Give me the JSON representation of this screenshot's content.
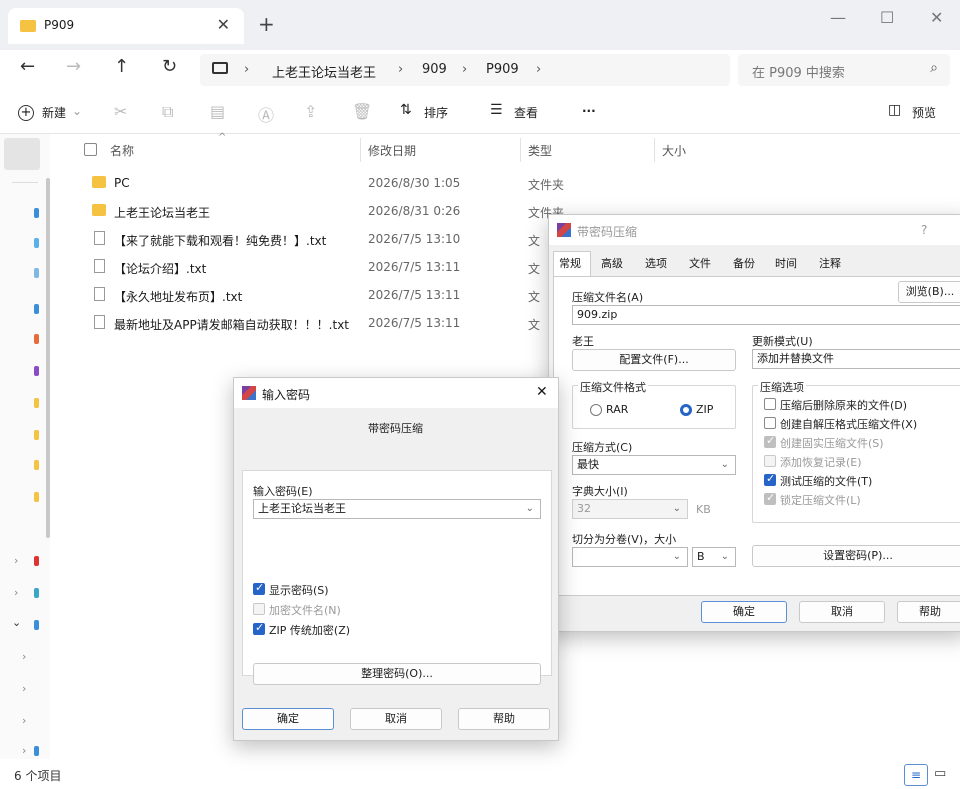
{
  "explorer": {
    "tab_title": "P909",
    "tab_close": "✕",
    "new_tab": "+",
    "window_controls": {
      "minimize": "—",
      "maximize": "☐",
      "close": "✕"
    },
    "nav": {
      "back": "←",
      "forward": "→",
      "up": "↑",
      "refresh": "↻"
    },
    "breadcrumbs": [
      "上老王论坛当老王",
      "909",
      "P909"
    ],
    "crumb_sep": "›",
    "search_placeholder": "在 P909 中搜索",
    "toolbar": {
      "new": "新建",
      "sort": "排序",
      "view": "查看",
      "more": "···",
      "preview": "预览"
    },
    "columns": {
      "name": "名称",
      "modified": "修改日期",
      "type": "类型",
      "size": "大小"
    },
    "files": [
      {
        "name": "PC",
        "date": "2026/8/30 1:05",
        "type": "文件夹",
        "kind": "folder"
      },
      {
        "name": "上老王论坛当老王",
        "date": "2026/8/31 0:26",
        "type": "文件夹",
        "kind": "folder"
      },
      {
        "name": "【来了就能下载和观看！纯免费！】.txt",
        "date": "2026/7/5 13:10",
        "type": "文",
        "kind": "txt"
      },
      {
        "name": "【论坛介绍】.txt",
        "date": "2026/7/5 13:11",
        "type": "文",
        "kind": "txt"
      },
      {
        "name": "【永久地址发布页】.txt",
        "date": "2026/7/5 13:11",
        "type": "文",
        "kind": "txt"
      },
      {
        "name": "最新地址及APP请发邮箱自动获取！！！.txt",
        "date": "2026/7/5 13:11",
        "type": "文",
        "kind": "txt"
      }
    ],
    "status": "6 个项目"
  },
  "compress_dialog": {
    "title": "带密码压缩",
    "help": "?",
    "tabs": [
      "常规",
      "高级",
      "选项",
      "文件",
      "备份",
      "时间",
      "注释"
    ],
    "archive_name_label": "压缩文件名(A)",
    "browse": "浏览(B)...",
    "archive_name": "909.zip",
    "profile_label": "老王",
    "profile_button": "配置文件(F)...",
    "update_mode_label": "更新模式(U)",
    "update_mode": "添加并替换文件",
    "format_label": "压缩文件格式",
    "format_rar": "RAR",
    "format_zip": "ZIP",
    "options_label": "压缩选项",
    "options": [
      {
        "label": "压缩后删除原来的文件(D)",
        "state": "off"
      },
      {
        "label": "创建自解压格式压缩文件(X)",
        "state": "off"
      },
      {
        "label": "创建固实压缩文件(S)",
        "state": "dison"
      },
      {
        "label": "添加恢复记录(E)",
        "state": "dis"
      },
      {
        "label": "测试压缩的文件(T)",
        "state": "on"
      },
      {
        "label": "锁定压缩文件(L)",
        "state": "dison"
      }
    ],
    "method_label": "压缩方式(C)",
    "method": "最快",
    "dict_label": "字典大小(I)",
    "dict_value": "32",
    "dict_unit": "KB",
    "split_label": "切分为分卷(V)，大小",
    "split_unit": "B",
    "set_password": "设置密码(P)...",
    "ok": "确定",
    "cancel": "取消",
    "helpbtn": "帮助"
  },
  "password_dialog": {
    "title": "输入密码",
    "close": "✕",
    "subtitle": "带密码压缩",
    "input_label": "输入密码(E)",
    "password_value": "上老王论坛当老王",
    "checks": [
      {
        "label": "显示密码(S)",
        "state": "on"
      },
      {
        "label": "加密文件名(N)",
        "state": "dis"
      },
      {
        "label": "ZIP 传统加密(Z)",
        "state": "on"
      }
    ],
    "organize": "整理密码(O)...",
    "ok": "确定",
    "cancel": "取消",
    "help": "帮助"
  }
}
